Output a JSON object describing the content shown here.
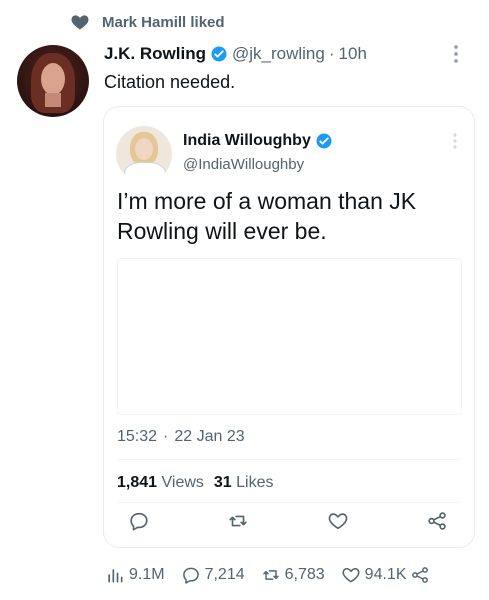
{
  "social_context": {
    "text": "Mark Hamill liked"
  },
  "tweet": {
    "author_name": "J.K. Rowling",
    "handle": "@jk_rowling",
    "separator": "·",
    "time": "10h",
    "text": "Citation needed."
  },
  "quoted_tweet": {
    "author_name": "India Willoughby",
    "handle": "@IndiaWilloughby",
    "text": "I’m more of a woman than JK Rowling will ever be.",
    "time": "15:32",
    "separator": "·",
    "date": "22 Jan 23",
    "views_count": "1,841",
    "views_label": "Views",
    "likes_count": "31",
    "likes_label": "Likes"
  },
  "bottom_stats": {
    "views": "9.1M",
    "replies": "7,214",
    "retweets": "6,783",
    "likes": "94.1K"
  },
  "colors": {
    "verified_blue": "#1d9bf0",
    "muted_text": "#536471",
    "primary_text": "#0f1419"
  },
  "icons": [
    "heart-icon",
    "verified-icon",
    "more-icon",
    "reply-icon",
    "retweet-icon",
    "like-icon",
    "share-icon",
    "views-icon"
  ]
}
